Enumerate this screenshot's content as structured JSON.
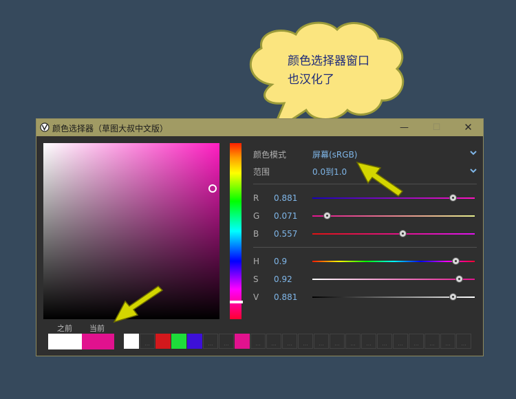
{
  "annotation": {
    "line1": "颜色选择器窗口",
    "line2": "也汉化了"
  },
  "window": {
    "title": "颜色选择器（草图大叔中文版）",
    "minimize_label": "—",
    "maximize_label": "☐",
    "close_label": "✕"
  },
  "colors": {
    "current": "#e1128e",
    "before": "#ffffff",
    "hue_marker": "#ffffff",
    "bubble": "#fbe57f",
    "accent_text": "#7fb6e8"
  },
  "picker": {
    "before_label": "之前",
    "current_label": "当前",
    "palette": [
      "#ffffff",
      "",
      "#d3181c",
      "#1edc3a",
      "#3d10d8",
      "",
      "",
      "#e1128e",
      "",
      "",
      "",
      "",
      "",
      "",
      "",
      "",
      "",
      "",
      "",
      "",
      "",
      ""
    ],
    "empty_cell_label": "..."
  },
  "panel": {
    "mode_label": "颜色模式",
    "mode_value": "屏幕(sRGB)",
    "range_label": "范围",
    "range_value": "0.0到1.0",
    "r_label": "R",
    "r_value": "0.881",
    "g_label": "G",
    "g_value": "0.071",
    "b_label": "B",
    "b_value": "0.557",
    "h_label": "H",
    "h_value": "0.9",
    "s_label": "S",
    "s_value": "0.92",
    "v_label": "V",
    "v_value": "0.881"
  }
}
